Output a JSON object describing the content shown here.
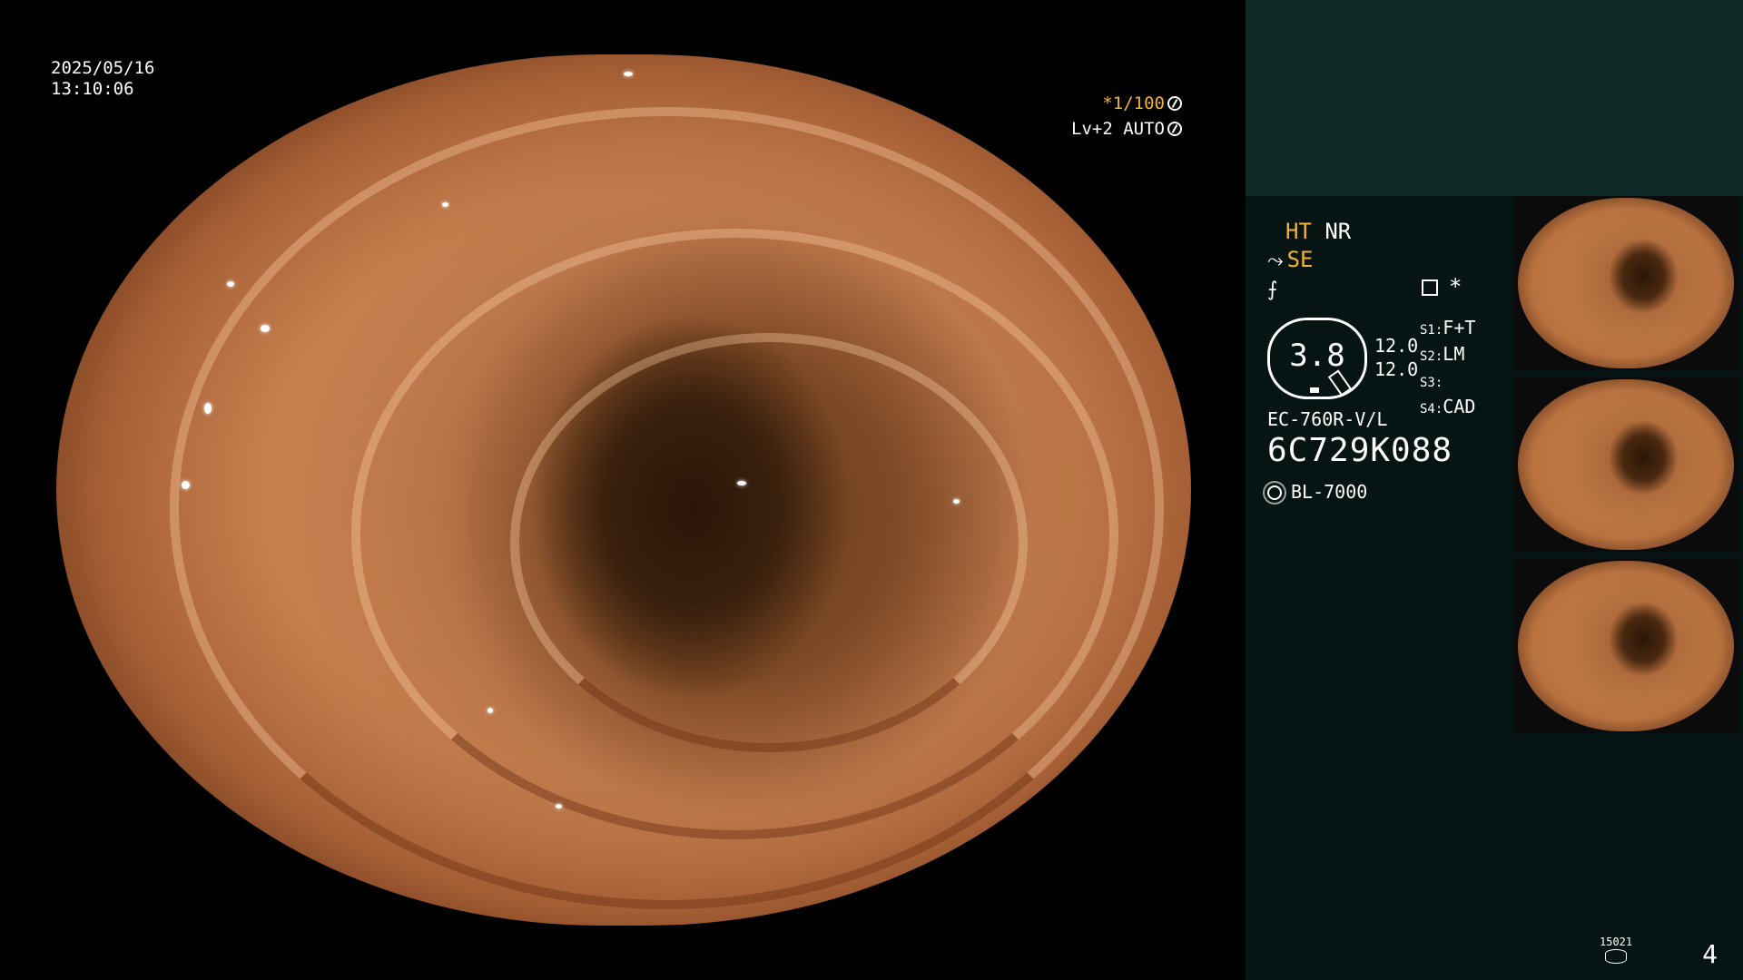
{
  "overlay": {
    "date": "2025/05/16",
    "time": "13:10:06",
    "shutter": "*1/100",
    "level": "Lv+2 AUTO"
  },
  "panel": {
    "ht_label": "HT",
    "nr_label": "NR",
    "se_label": "SE",
    "star": "*",
    "value_main": "3.8",
    "value_a": "12.0",
    "value_b": "12.0",
    "slots": [
      {
        "key": "S1:",
        "val": "F+T"
      },
      {
        "key": "S2:",
        "val": "LM"
      },
      {
        "key": "S3:",
        "val": ""
      },
      {
        "key": "S4:",
        "val": "CAD"
      }
    ],
    "model": "EC-760R-V/L",
    "serial": "6C729K088",
    "light_source": "BL-7000"
  },
  "footer": {
    "disk_label": "15021",
    "image_count": "4"
  },
  "colors": {
    "accent": "#f2b233",
    "panel_bg": "#061513",
    "panel_top": "#0f2a26"
  },
  "icons": [
    "shutter-icon",
    "auto-icon",
    "pencil-icon",
    "filter-icon",
    "config-icon",
    "lamp-icon",
    "disk-icon"
  ]
}
